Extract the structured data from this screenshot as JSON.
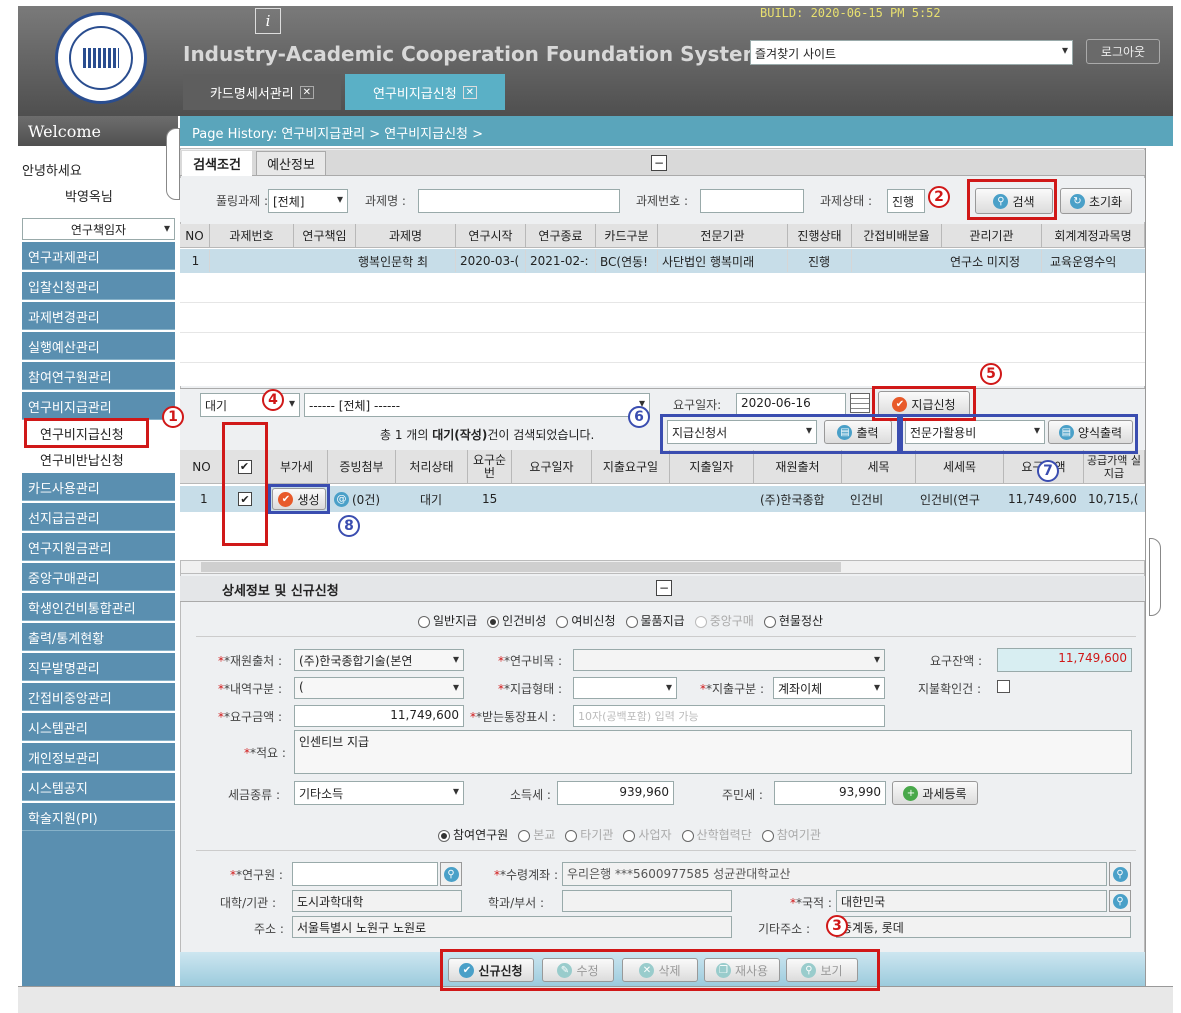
{
  "app": {
    "build": "BUILD: 2020-06-15 PM 5:52",
    "title": "Industry-Academic Cooperation Foundation System",
    "favorites_select": "즐겨찾기 사이트",
    "logout": "로그아웃",
    "info_icon": "i"
  },
  "tabs": [
    {
      "label": "카드명세서관리"
    },
    {
      "label": "연구비지급신청"
    }
  ],
  "breadcrumb": "Page History:  연구비지급관리 > 연구비지급신청 >",
  "sidebar": {
    "welcome": "Welcome",
    "greeting": "안녕하세요",
    "user_name": "박영옥님",
    "role_select": "연구책임자",
    "items": [
      {
        "label": "연구과제관리"
      },
      {
        "label": "입찰신청관리"
      },
      {
        "label": "과제변경관리"
      },
      {
        "label": "실행예산관리"
      },
      {
        "label": "참여연구원관리"
      },
      {
        "label": "연구비지급관리"
      },
      {
        "label": "연구비지급신청"
      },
      {
        "label": "연구비반납신청"
      },
      {
        "label": "카드사용관리"
      },
      {
        "label": "선지급금관리"
      },
      {
        "label": "연구지원금관리"
      },
      {
        "label": "중앙구매관리"
      },
      {
        "label": "학생인건비통합관리"
      },
      {
        "label": "출력/통계현황"
      },
      {
        "label": "직무발명관리"
      },
      {
        "label": "간접비중앙관리"
      },
      {
        "label": "시스템관리"
      },
      {
        "label": "개인정보관리"
      },
      {
        "label": "시스템공지"
      },
      {
        "label": "학술지원(PI)"
      }
    ]
  },
  "search": {
    "tab_condition": "검색조건",
    "tab_budget": "예산정보",
    "collapse": "−",
    "pooling_label": "풀링과제 :",
    "pooling_value": "[전체]",
    "project_name_label": "과제명 :",
    "project_no_label": "과제번호 :",
    "status_label": "과제상태 :",
    "status_value": "진행",
    "search_button": "검색",
    "reset_button": "초기화"
  },
  "project_table": {
    "headers": [
      "NO",
      "과제번호",
      "연구책임",
      "과제명",
      "연구시작",
      "연구종료",
      "카드구분",
      "전문기관",
      "진행상태",
      "간접비배분율",
      "관리기관",
      "회계계정과목명"
    ],
    "rows": [
      [
        "1",
        "",
        "",
        "행복인문학 최",
        "2020-03-(",
        "2021-02-:",
        "BC(연동!",
        "사단법인 행복미래",
        "진행",
        "",
        "연구소 미지정",
        "교육운영수익"
      ]
    ]
  },
  "payment": {
    "status_select": "대기",
    "category_select": "------ [전체] ------",
    "request_date_label": "요구일자:",
    "request_date": "2020-06-16",
    "apply_button": "지급신청",
    "result_text_pre": "총 1 개의 ",
    "result_text_bold": "대기(작성)",
    "result_text_post": "건이 검색되었습니다.",
    "form_select": "지급신청서",
    "print_button": "출력",
    "form_select2": "전문가활용비",
    "form_print_button": "양식출력",
    "headers": [
      "NO",
      "✔",
      "부가세",
      "증빙첨부",
      "처리상태",
      "요구순번",
      "요구일자",
      "지출요구일",
      "지출일자",
      "재원출처",
      "세목",
      "세세목",
      "요구금액",
      "공급가액 실지급"
    ],
    "row": {
      "no": "1",
      "checked": "✔",
      "create_button": "생성",
      "attach": "(0건)",
      "status": "대기",
      "seq": "15",
      "source": "(주)한국종합",
      "item": "인건비",
      "subitem": "인건비(연구",
      "amount": "11,749,600",
      "supply": "10,715,("
    }
  },
  "detail": {
    "title": "상세정보 및 신규신청",
    "pay_types": [
      {
        "label": "일반지급",
        "selected": false
      },
      {
        "label": "인건비성",
        "selected": true
      },
      {
        "label": "여비신청",
        "selected": false
      },
      {
        "label": "물품지급",
        "selected": false
      },
      {
        "label": "중앙구매",
        "selected": false
      },
      {
        "label": "현물정산",
        "selected": false
      }
    ],
    "fund_source_label": "*재원출처 :",
    "fund_source_value": "(주)한국종합기술(본연",
    "research_item_label": "*연구비목 :",
    "remaining_label": "요구잔액 :",
    "remaining_value": "11,749,600",
    "category_label": "*내역구분 :",
    "category_value": "(",
    "pay_form_label": "*지급형태 :",
    "expense_type_label": "*지출구분 :",
    "expense_type_value": "계좌이체",
    "payment_check_label": "지불확인건 :",
    "request_amount_label": "*요구금액 :",
    "request_amount_value": "11,749,600",
    "account_display_label": "*받는통장표시 :",
    "account_display_placeholder": "10자(공백포함) 입력 가능",
    "summary_label": "*적요 :",
    "summary_value": "인센티브 지급",
    "tax_type_label": "세금종류 :",
    "tax_type_value": "기타소득",
    "income_tax_label": "소득세 :",
    "income_tax_value": "939,960",
    "resident_tax_label": "주민세 :",
    "resident_tax_value": "93,990",
    "tax_register_button": "과세등록",
    "payee_types": [
      {
        "label": "참여연구원",
        "selected": true
      },
      {
        "label": "본교",
        "selected": false
      },
      {
        "label": "타기관",
        "selected": false
      },
      {
        "label": "사업자",
        "selected": false
      },
      {
        "label": "산학협력단",
        "selected": false
      },
      {
        "label": "참여기관",
        "selected": false
      }
    ],
    "researcher_label": "*연구원 :",
    "account_label": "*수령계좌 :",
    "account_value": "우리은행 ***5600977585 성균관대학교산",
    "org_label": "대학/기관 :",
    "org_value": "도시과학대학",
    "dept_label": "학과/부서 :",
    "nationality_label": "*국적 :",
    "nationality_value": "대한민국",
    "address_label": "주소 :",
    "address_value": "서울특별시 노원구 노원로",
    "other_address_label": "기타주소 :",
    "other_address_value": "중계동, 롯데"
  },
  "actions": {
    "new_button": "신규신청",
    "edit_button": "수정",
    "delete_button": "삭제",
    "reuse_button": "재사용",
    "view_button": "보기"
  },
  "markers": [
    "1",
    "2",
    "3",
    "4",
    "5",
    "6",
    "7",
    "8"
  ],
  "colors": {
    "header_bg": "#6b6b6b",
    "menu_bg": "#5a8fb0",
    "annotation_red": "#d01818",
    "annotation_blue": "#3a4db0"
  }
}
